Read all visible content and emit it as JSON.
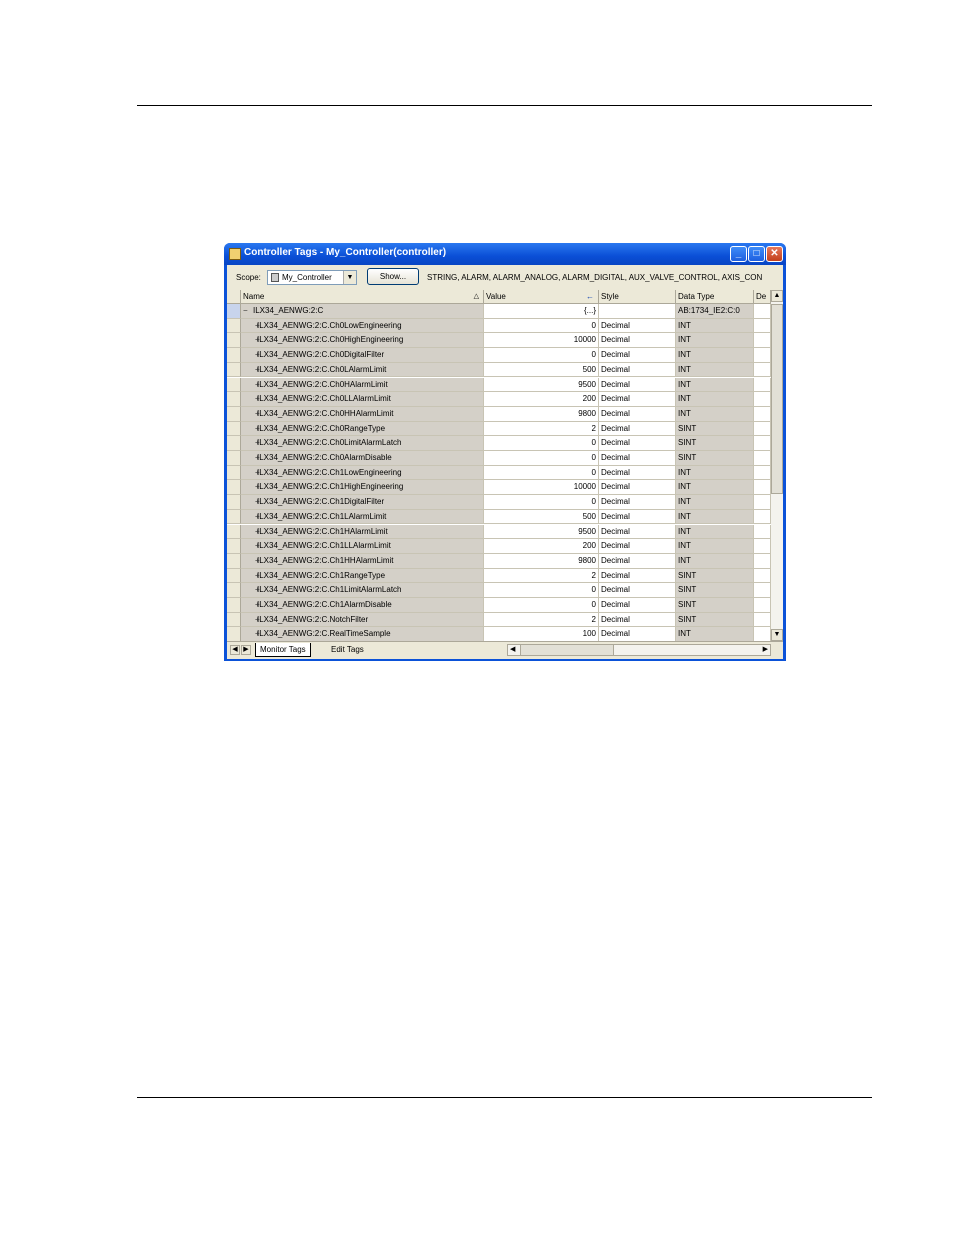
{
  "window": {
    "title": "Controller Tags - My_Controller(controller)",
    "minimize": "_",
    "maximize": "□",
    "close": "✕"
  },
  "scope": {
    "label": "Scope:",
    "value": "My_Controller",
    "show_button": "Show...",
    "filter": "STRING, ALARM, ALARM_ANALOG, ALARM_DIGITAL, AUX_VALVE_CONTROL, AXIS_CON"
  },
  "columns": {
    "name": "Name",
    "value": "Value",
    "style": "Style",
    "type": "Data Type",
    "desc": "De"
  },
  "rows": [
    {
      "expander": "−",
      "name": "ILX34_AENWG:2:C",
      "value": "{...}",
      "style": "",
      "type": "AB:1734_IE2:C:0"
    },
    {
      "expander": "+",
      "name": "ILX34_AENWG:2:C.Ch0LowEngineering",
      "value": "0",
      "style": "Decimal",
      "type": "INT"
    },
    {
      "expander": "+",
      "name": "ILX34_AENWG:2:C.Ch0HighEngineering",
      "value": "10000",
      "style": "Decimal",
      "type": "INT"
    },
    {
      "expander": "+",
      "name": "ILX34_AENWG:2:C.Ch0DigitalFilter",
      "value": "0",
      "style": "Decimal",
      "type": "INT"
    },
    {
      "expander": "+",
      "name": "ILX34_AENWG:2:C.Ch0LAlarmLimit",
      "value": "500",
      "style": "Decimal",
      "type": "INT"
    },
    {
      "expander": "+",
      "name": "ILX34_AENWG:2:C.Ch0HAlarmLimit",
      "value": "9500",
      "style": "Decimal",
      "type": "INT"
    },
    {
      "expander": "+",
      "name": "ILX34_AENWG:2:C.Ch0LLAlarmLimit",
      "value": "200",
      "style": "Decimal",
      "type": "INT"
    },
    {
      "expander": "+",
      "name": "ILX34_AENWG:2:C.Ch0HHAlarmLimit",
      "value": "9800",
      "style": "Decimal",
      "type": "INT"
    },
    {
      "expander": "+",
      "name": "ILX34_AENWG:2:C.Ch0RangeType",
      "value": "2",
      "style": "Decimal",
      "type": "SINT"
    },
    {
      "expander": "+",
      "name": "ILX34_AENWG:2:C.Ch0LimitAlarmLatch",
      "value": "0",
      "style": "Decimal",
      "type": "SINT"
    },
    {
      "expander": "+",
      "name": "ILX34_AENWG:2:C.Ch0AlarmDisable",
      "value": "0",
      "style": "Decimal",
      "type": "SINT"
    },
    {
      "expander": "+",
      "name": "ILX34_AENWG:2:C.Ch1LowEngineering",
      "value": "0",
      "style": "Decimal",
      "type": "INT"
    },
    {
      "expander": "+",
      "name": "ILX34_AENWG:2:C.Ch1HighEngineering",
      "value": "10000",
      "style": "Decimal",
      "type": "INT"
    },
    {
      "expander": "+",
      "name": "ILX34_AENWG:2:C.Ch1DigitalFilter",
      "value": "0",
      "style": "Decimal",
      "type": "INT"
    },
    {
      "expander": "+",
      "name": "ILX34_AENWG:2:C.Ch1LAlarmLimit",
      "value": "500",
      "style": "Decimal",
      "type": "INT"
    },
    {
      "expander": "+",
      "name": "ILX34_AENWG:2:C.Ch1HAlarmLimit",
      "value": "9500",
      "style": "Decimal",
      "type": "INT"
    },
    {
      "expander": "+",
      "name": "ILX34_AENWG:2:C.Ch1LLAlarmLimit",
      "value": "200",
      "style": "Decimal",
      "type": "INT"
    },
    {
      "expander": "+",
      "name": "ILX34_AENWG:2:C.Ch1HHAlarmLimit",
      "value": "9800",
      "style": "Decimal",
      "type": "INT"
    },
    {
      "expander": "+",
      "name": "ILX34_AENWG:2:C.Ch1RangeType",
      "value": "2",
      "style": "Decimal",
      "type": "SINT"
    },
    {
      "expander": "+",
      "name": "ILX34_AENWG:2:C.Ch1LimitAlarmLatch",
      "value": "0",
      "style": "Decimal",
      "type": "SINT"
    },
    {
      "expander": "+",
      "name": "ILX34_AENWG:2:C.Ch1AlarmDisable",
      "value": "0",
      "style": "Decimal",
      "type": "SINT"
    },
    {
      "expander": "+",
      "name": "ILX34_AENWG:2:C.NotchFilter",
      "value": "2",
      "style": "Decimal",
      "type": "SINT"
    },
    {
      "expander": "+",
      "name": "ILX34_AENWG:2:C.RealTimeSample",
      "value": "100",
      "style": "Decimal",
      "type": "INT"
    }
  ],
  "tabs": {
    "monitor": "Monitor Tags",
    "edit": "Edit Tags"
  }
}
